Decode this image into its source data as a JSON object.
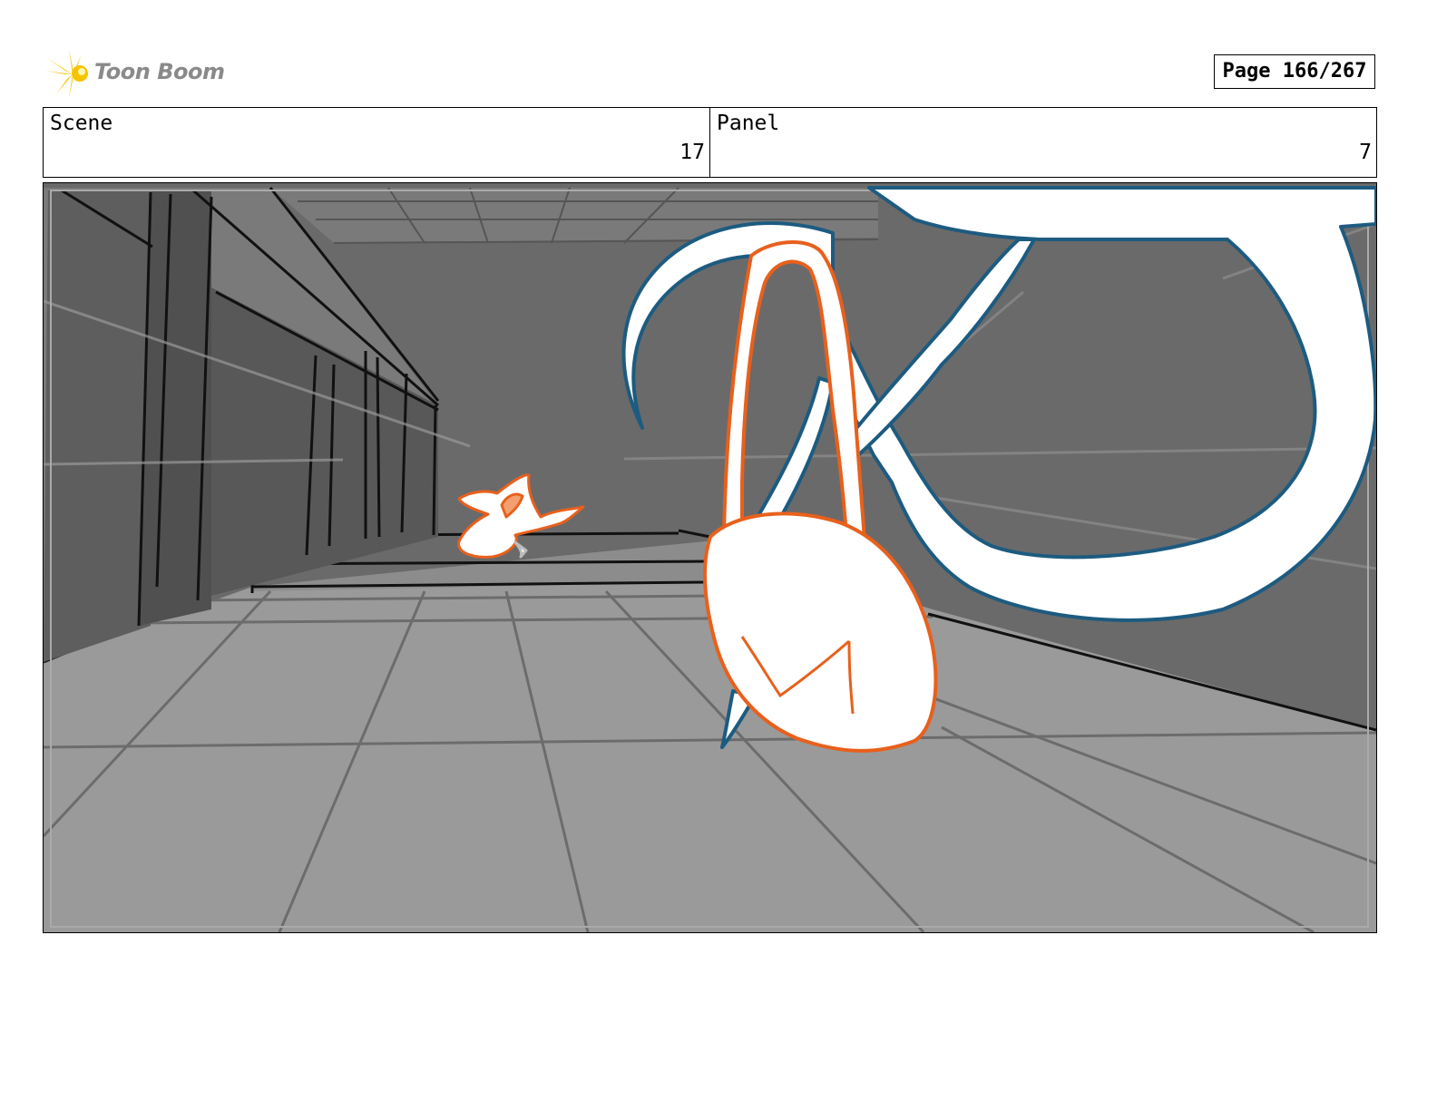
{
  "header": {
    "logo_text": "Toon Boom",
    "page_label": "Page 166/267"
  },
  "info": {
    "scene_label": "Scene",
    "scene_value": "17",
    "panel_label": "Panel",
    "panel_value": "7"
  },
  "colors": {
    "accent_orange": "#e8601c",
    "accent_blue": "#1d5b80",
    "logo_yellow": "#f5c400"
  }
}
